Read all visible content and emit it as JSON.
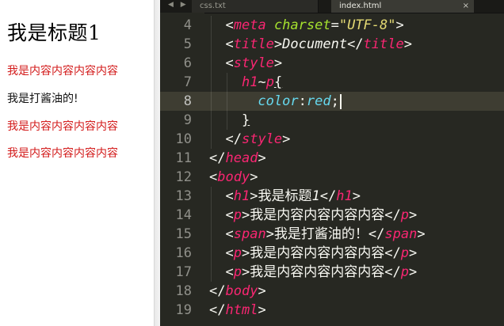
{
  "preview": {
    "heading": "我是标题1",
    "lines": [
      {
        "text": "我是内容内容内容内容",
        "color": "#d31b1b"
      },
      {
        "text": "我是打酱油的!",
        "color": "#111111"
      },
      {
        "text": "我是内容内容内容内容",
        "color": "#d31b1b"
      },
      {
        "text": "我是内容内容内容内容",
        "color": "#d31b1b"
      }
    ]
  },
  "editor": {
    "tabs": [
      {
        "label": "css.txt",
        "active": false
      },
      {
        "label": "index.html",
        "active": true,
        "close": "×"
      }
    ],
    "nav_arrows": "◀ ▶",
    "current_line": 8,
    "colors": {
      "background": "#272822",
      "tag": "#f92672",
      "attribute": "#a6e22e",
      "string": "#e6db74",
      "property": "#66d9ef",
      "plain": "#f8f8f2"
    },
    "lines": [
      {
        "num": "4",
        "indent": "  ",
        "tokens": [
          [
            "plain",
            "<"
          ],
          [
            "tag",
            "meta"
          ],
          [
            "plain",
            " "
          ],
          [
            "attr",
            "charset"
          ],
          [
            "plain",
            "="
          ],
          [
            "str",
            "\"UTF-8\""
          ],
          [
            "plain",
            ">"
          ]
        ]
      },
      {
        "num": "5",
        "indent": "  ",
        "tokens": [
          [
            "plain",
            "<"
          ],
          [
            "tag",
            "title"
          ],
          [
            "plain",
            ">"
          ],
          [
            "italic",
            "Document"
          ],
          [
            "plain",
            "</"
          ],
          [
            "tag",
            "title"
          ],
          [
            "plain",
            ">"
          ]
        ]
      },
      {
        "num": "6",
        "indent": "  ",
        "tokens": [
          [
            "plain",
            "<"
          ],
          [
            "tag",
            "style"
          ],
          [
            "plain",
            ">"
          ]
        ]
      },
      {
        "num": "7",
        "indent": "    ",
        "tokens": [
          [
            "tag",
            "h1"
          ],
          [
            "plain",
            "~"
          ],
          [
            "tag",
            "p"
          ],
          [
            "plain_ul",
            "{"
          ]
        ]
      },
      {
        "num": "8",
        "indent": "      ",
        "tokens": [
          [
            "prop",
            "color"
          ],
          [
            "plain",
            ":"
          ],
          [
            "prop",
            "red"
          ],
          [
            "plain",
            ";"
          ],
          [
            "cursor",
            ""
          ]
        ]
      },
      {
        "num": "9",
        "indent": "    ",
        "tokens": [
          [
            "plain_ul",
            "}"
          ]
        ]
      },
      {
        "num": "10",
        "indent": "  ",
        "tokens": [
          [
            "plain",
            "</"
          ],
          [
            "tag",
            "style"
          ],
          [
            "plain",
            ">"
          ]
        ]
      },
      {
        "num": "11",
        "indent": "",
        "tokens": [
          [
            "plain",
            "</"
          ],
          [
            "tag",
            "head"
          ],
          [
            "plain",
            ">"
          ]
        ]
      },
      {
        "num": "12",
        "indent": "",
        "tokens": [
          [
            "plain",
            "<"
          ],
          [
            "tag",
            "body"
          ],
          [
            "plain",
            ">"
          ]
        ]
      },
      {
        "num": "13",
        "indent": "  ",
        "tokens": [
          [
            "plain",
            "<"
          ],
          [
            "tag",
            "h1"
          ],
          [
            "plain",
            ">我是标题"
          ],
          [
            "italic",
            "1"
          ],
          [
            "plain",
            "</"
          ],
          [
            "tag",
            "h1"
          ],
          [
            "plain",
            ">"
          ]
        ]
      },
      {
        "num": "14",
        "indent": "  ",
        "tokens": [
          [
            "plain",
            "<"
          ],
          [
            "tag",
            "p"
          ],
          [
            "plain",
            ">我是内容内容内容内容</"
          ],
          [
            "tag",
            "p"
          ],
          [
            "plain",
            ">"
          ]
        ]
      },
      {
        "num": "15",
        "indent": "  ",
        "tokens": [
          [
            "plain",
            "<"
          ],
          [
            "tag",
            "span"
          ],
          [
            "plain",
            ">我是打酱油的！</"
          ],
          [
            "tag",
            "span"
          ],
          [
            "plain",
            ">"
          ]
        ]
      },
      {
        "num": "16",
        "indent": "  ",
        "tokens": [
          [
            "plain",
            "<"
          ],
          [
            "tag",
            "p"
          ],
          [
            "plain",
            ">我是内容内容内容内容</"
          ],
          [
            "tag",
            "p"
          ],
          [
            "plain",
            ">"
          ]
        ]
      },
      {
        "num": "17",
        "indent": "  ",
        "tokens": [
          [
            "plain",
            "<"
          ],
          [
            "tag",
            "p"
          ],
          [
            "plain",
            ">我是内容内容内容内容</"
          ],
          [
            "tag",
            "p"
          ],
          [
            "plain",
            ">"
          ]
        ]
      },
      {
        "num": "18",
        "indent": "",
        "tokens": [
          [
            "plain",
            "</"
          ],
          [
            "tag",
            "body"
          ],
          [
            "plain",
            ">"
          ]
        ]
      },
      {
        "num": "19",
        "indent": "",
        "tokens": [
          [
            "plain",
            "</"
          ],
          [
            "tag",
            "html"
          ],
          [
            "plain",
            ">"
          ]
        ]
      }
    ]
  }
}
